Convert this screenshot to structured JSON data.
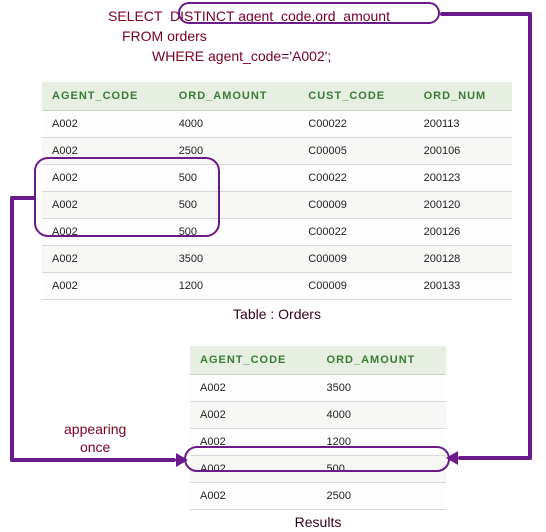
{
  "sql": {
    "line1_pre": "SELECT  ",
    "line1_distinct": "DISTINCT agent_code,ord_amount",
    "line2": "FROM orders",
    "line3": "WHERE agent_code='A002';"
  },
  "orders": {
    "caption": "Table : Orders",
    "headers": [
      "AGENT_CODE",
      "ORD_AMOUNT",
      "CUST_CODE",
      "ORD_NUM"
    ],
    "rows": [
      [
        "A002",
        "4000",
        "C00022",
        "200113"
      ],
      [
        "A002",
        "2500",
        "C00005",
        "200106"
      ],
      [
        "A002",
        "500",
        "C00022",
        "200123"
      ],
      [
        "A002",
        "500",
        "C00009",
        "200120"
      ],
      [
        "A002",
        "500",
        "C00022",
        "200126"
      ],
      [
        "A002",
        "3500",
        "C00009",
        "200128"
      ],
      [
        "A002",
        "1200",
        "C00009",
        "200133"
      ]
    ]
  },
  "results": {
    "caption": "Results",
    "headers": [
      "AGENT_CODE",
      "ORD_AMOUNT"
    ],
    "rows": [
      [
        "A002",
        "3500"
      ],
      [
        "A002",
        "4000"
      ],
      [
        "A002",
        "1200"
      ],
      [
        "A002",
        "500"
      ],
      [
        "A002",
        "2500"
      ]
    ]
  },
  "labels": {
    "appearing": "appearing\nonce"
  },
  "colors": {
    "sql_text": "#7b0020",
    "highlight": "#6a1a8a",
    "header_bg": "#e7efe2",
    "header_fg": "#3a7a36"
  }
}
